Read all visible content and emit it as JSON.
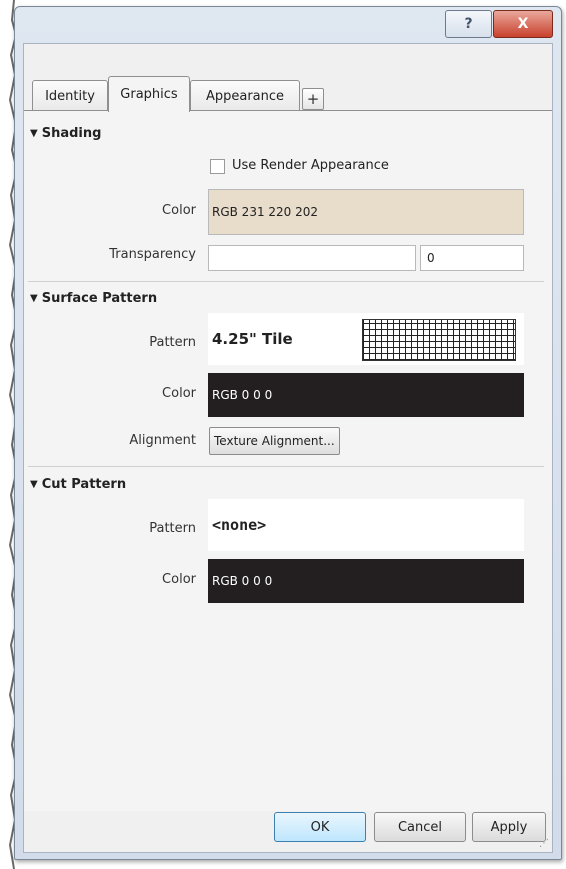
{
  "titlebar": {
    "help_glyph": "?",
    "close_glyph": "X"
  },
  "tabs": [
    {
      "label": "Identity",
      "active": false
    },
    {
      "label": "Graphics",
      "active": true
    },
    {
      "label": "Appearance",
      "active": false
    }
  ],
  "add_tab_glyph": "+",
  "shading": {
    "header": "Shading",
    "use_render_appearance": {
      "label": "Use Render Appearance",
      "checked": false
    },
    "color": {
      "label": "Color",
      "value": "RGB 231 220 202",
      "swatch": "#e8dccb"
    },
    "transparency": {
      "label": "Transparency",
      "value": "0"
    }
  },
  "surface_pattern": {
    "header": "Surface Pattern",
    "pattern": {
      "label": "Pattern",
      "value": "4.25\" Tile"
    },
    "color": {
      "label": "Color",
      "value": "RGB 0 0 0",
      "swatch": "#231f20"
    },
    "alignment": {
      "label": "Alignment",
      "button": "Texture Alignment..."
    }
  },
  "cut_pattern": {
    "header": "Cut Pattern",
    "pattern": {
      "label": "Pattern",
      "value": "<none>"
    },
    "color": {
      "label": "Color",
      "value": "RGB 0 0 0",
      "swatch": "#231f20"
    }
  },
  "footer": {
    "ok": "OK",
    "cancel": "Cancel",
    "apply": "Apply"
  }
}
